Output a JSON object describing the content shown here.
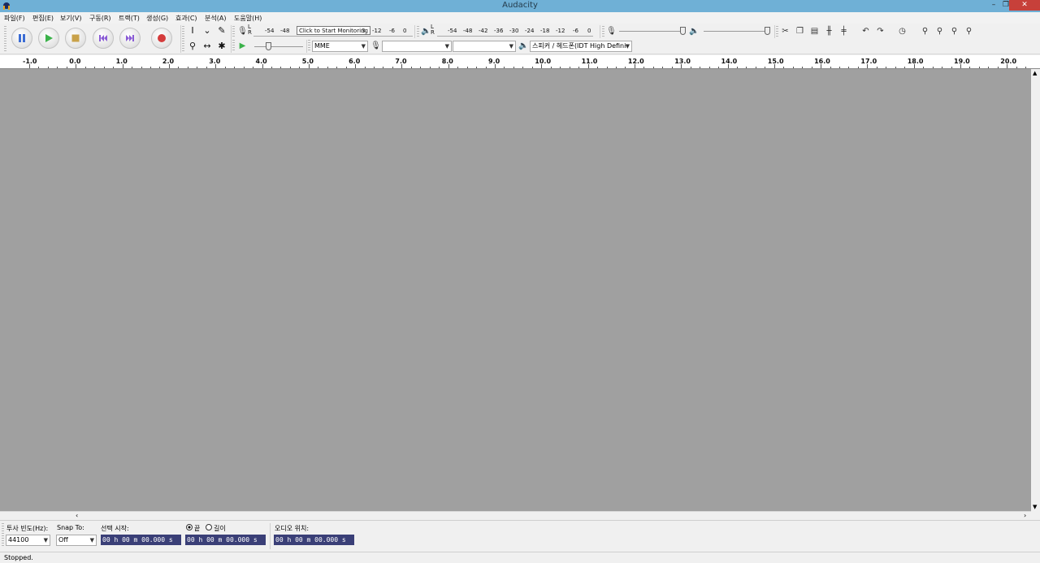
{
  "window": {
    "title": "Audacity",
    "minimize": "–",
    "restore": "❐",
    "close": "✕"
  },
  "menu": [
    "파일(F)",
    "편집(E)",
    "보기(V)",
    "구동(R)",
    "트랙(T)",
    "생성(G)",
    "효과(C)",
    "분석(A)",
    "도움말(H)"
  ],
  "meters": {
    "record_scale": [
      "-54",
      "-48"
    ],
    "record_tooltip": "Click to Start Monitoring",
    "record_scale_right": [
      "3",
      "-12",
      "-6",
      "0"
    ],
    "play_scale": [
      "-54",
      "-48",
      "-42",
      "-36",
      "-30",
      "-24",
      "-18",
      "-12",
      "-6",
      "0"
    ],
    "lr": "L R"
  },
  "device": {
    "host": "MME",
    "input": "",
    "channels": "",
    "output": "스피커 / 헤드폰(IDT High Defini"
  },
  "ruler": [
    "-1.0",
    "0.0",
    "1.0",
    "2.0",
    "3.0",
    "4.0",
    "5.0",
    "6.0",
    "7.0",
    "8.0",
    "9.0",
    "10.0",
    "11.0",
    "12.0",
    "13.0",
    "14.0",
    "15.0",
    "16.0",
    "17.0",
    "18.0",
    "19.0",
    "20.0"
  ],
  "selection": {
    "rate_label": "투사 빈도(Hz):",
    "rate_value": "44100",
    "snap_label": "Snap To:",
    "snap_value": "Off",
    "start_label": "선택 시작:",
    "end_label": "끝",
    "length_label": "길이",
    "start_time": "00 h 00 m 00.000 s",
    "end_time": "00 h 00 m 00.000 s",
    "audio_pos_label": "오디오 위치:",
    "audio_pos_time": "00 h 00 m 00.000 s"
  },
  "status": "Stopped."
}
